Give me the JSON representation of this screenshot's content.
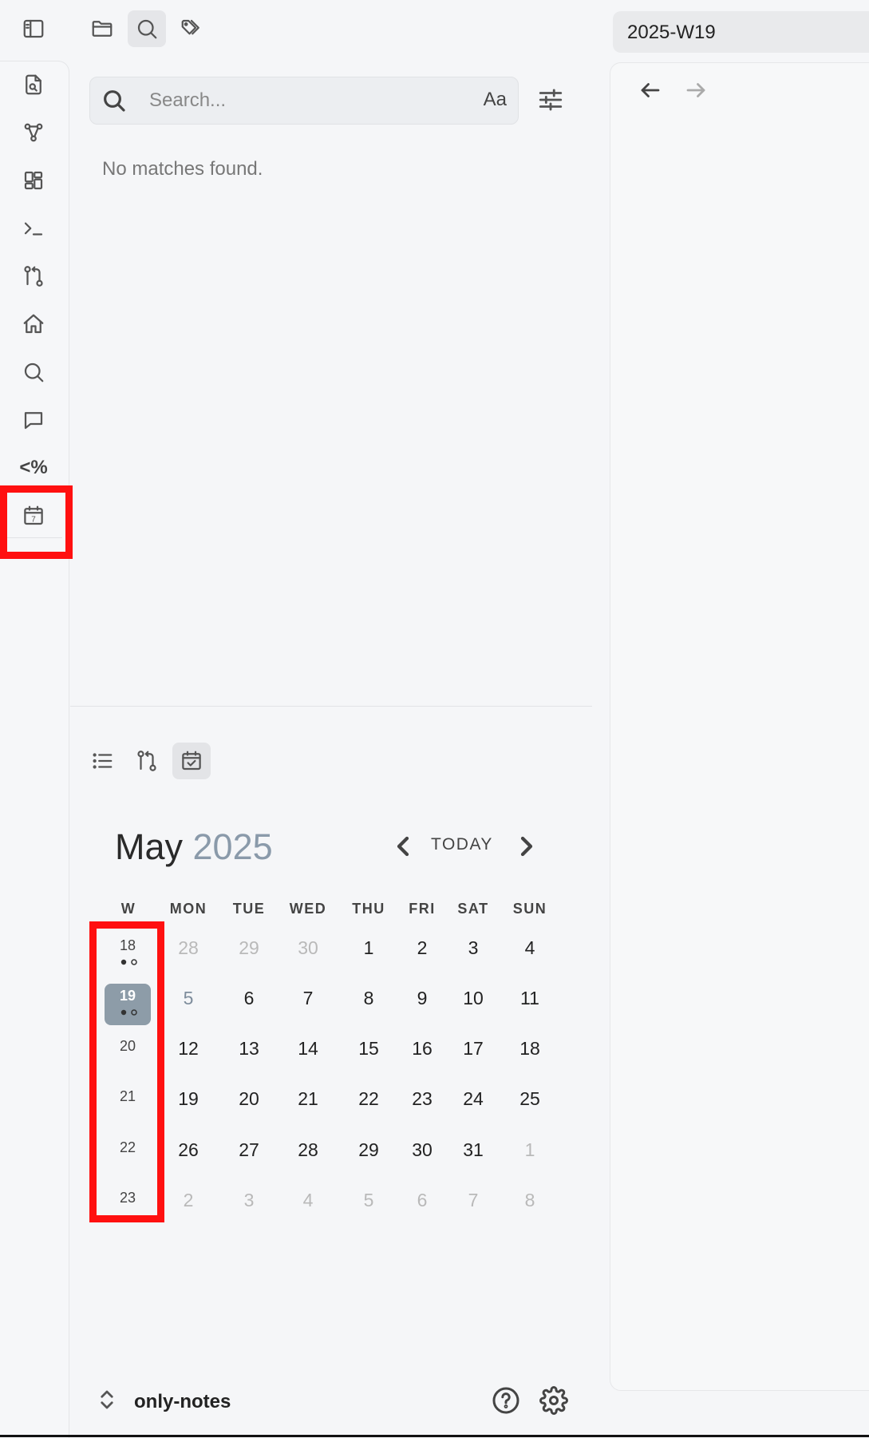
{
  "ribbon": {
    "toggle_icon": "sidebar-toggle-icon",
    "items": [
      {
        "name": "open-quick-switcher-icon"
      },
      {
        "name": "graph-view-icon"
      },
      {
        "name": "canvas-icon"
      },
      {
        "name": "command-palette-icon"
      },
      {
        "name": "git-icon"
      },
      {
        "name": "home-icon"
      },
      {
        "name": "search-icon"
      },
      {
        "name": "chat-icon"
      },
      {
        "name": "templater-icon",
        "label": "<%"
      },
      {
        "name": "calendar-icon",
        "label": "7"
      }
    ]
  },
  "sidebar_tabs": [
    {
      "name": "file-explorer-icon"
    },
    {
      "name": "search-icon",
      "active": true
    },
    {
      "name": "tags-icon"
    }
  ],
  "search": {
    "placeholder": "Search...",
    "match_case_label": "Aa",
    "no_results": "No matches found."
  },
  "bottom_tabs": [
    {
      "name": "outline-icon"
    },
    {
      "name": "git-icon"
    },
    {
      "name": "calendar-check-icon",
      "active": true
    }
  ],
  "calendar": {
    "month": "May",
    "year": "2025",
    "today_label": "TODAY",
    "week_header": "W",
    "day_headers": [
      "MON",
      "TUE",
      "WED",
      "THU",
      "FRI",
      "SAT",
      "SUN"
    ],
    "weeks": [
      {
        "week": "18",
        "has_dots": true,
        "days": [
          "28",
          "29",
          "30",
          "1",
          "2",
          "3",
          "4"
        ]
      },
      {
        "week": "19",
        "has_dots": true,
        "selected": true,
        "days": [
          "5",
          "6",
          "7",
          "8",
          "9",
          "10",
          "11"
        ]
      },
      {
        "week": "20",
        "days": [
          "12",
          "13",
          "14",
          "15",
          "16",
          "17",
          "18"
        ]
      },
      {
        "week": "21",
        "days": [
          "19",
          "20",
          "21",
          "22",
          "23",
          "24",
          "25"
        ]
      },
      {
        "week": "22",
        "days": [
          "26",
          "27",
          "28",
          "29",
          "30",
          "31",
          "1"
        ]
      },
      {
        "week": "23",
        "days": [
          "2",
          "3",
          "4",
          "5",
          "6",
          "7",
          "8"
        ]
      }
    ],
    "colors": {
      "year": "#8a9aaa",
      "selected_week": "#8d9ca8",
      "muted_day": "#b9b9b9"
    }
  },
  "footer": {
    "vault_name": "only-notes",
    "help_icon": "help-icon",
    "settings_icon": "gear-icon"
  },
  "editor": {
    "tab_title": "2025-W19"
  },
  "highlight_color": "#ff1010"
}
